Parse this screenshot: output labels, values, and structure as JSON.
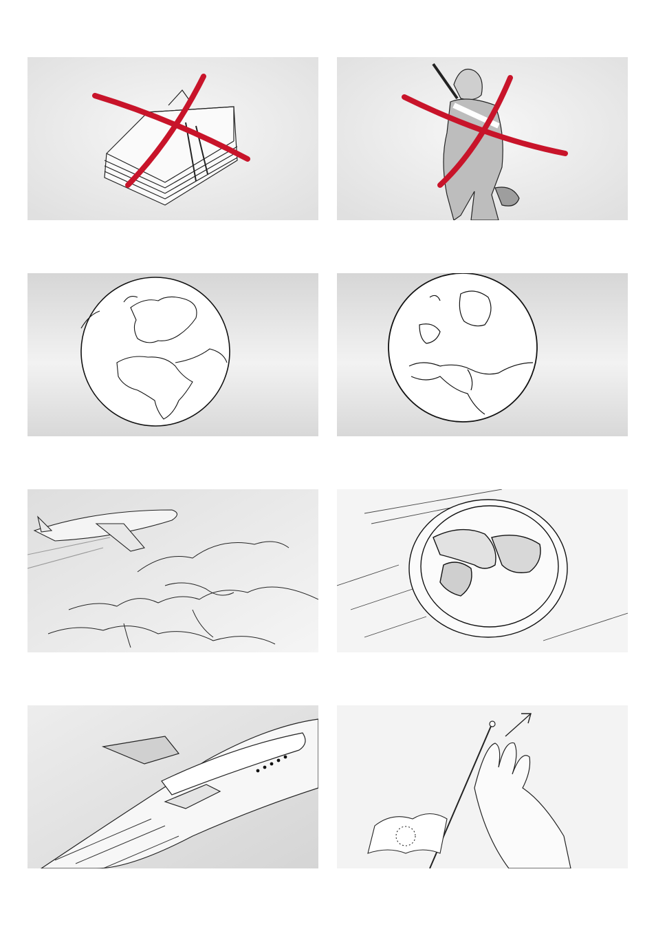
{
  "storyboard": {
    "panels": [
      {
        "id": "money-stack-crossed",
        "crossed_out": true
      },
      {
        "id": "armed-soldier-crossed",
        "crossed_out": true
      },
      {
        "id": "globe-africa-europe",
        "crossed_out": false
      },
      {
        "id": "globe-europe-closeup",
        "crossed_out": false
      },
      {
        "id": "airplane-over-europe-map",
        "crossed_out": false
      },
      {
        "id": "figures-inside-bubble",
        "crossed_out": false
      },
      {
        "id": "airplane-closeup",
        "crossed_out": false
      },
      {
        "id": "hand-eu-flag-arrow",
        "crossed_out": false
      }
    ]
  },
  "colors": {
    "cross_red": "#c8142a",
    "ink": "#1a1a1a",
    "paper_light": "#f4f4f4",
    "paper_grey": "#dcdcdc"
  }
}
